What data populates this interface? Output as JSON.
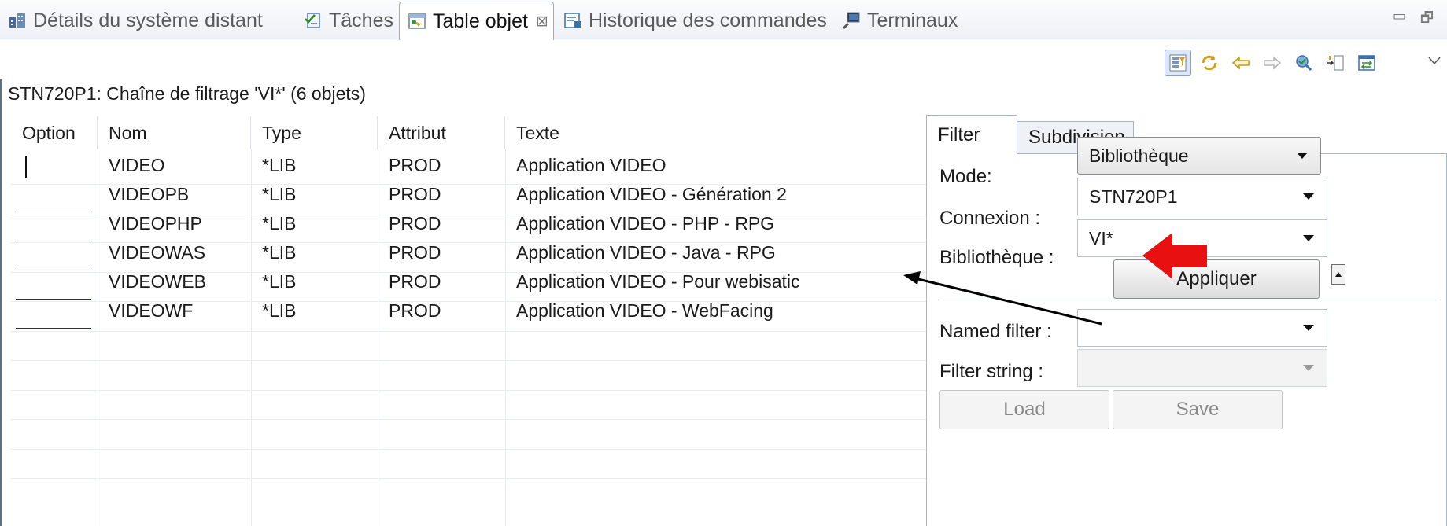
{
  "tabs": [
    {
      "label": "Détails du système distant",
      "icon": "remote-system-details-icon"
    },
    {
      "label": "Tâches",
      "icon": "tasks-icon"
    },
    {
      "label": "Table objet",
      "icon": "object-table-icon",
      "active": true
    },
    {
      "label": "Historique des commandes",
      "icon": "command-history-icon"
    },
    {
      "label": "Terminaux",
      "icon": "terminals-icon"
    }
  ],
  "window_controls": {
    "minimize": "▭",
    "maximize": "🗗"
  },
  "toolbar_icons": [
    "show-filter-panel-icon",
    "refresh-icon",
    "back-icon",
    "forward-icon",
    "remote-search-icon",
    "columns-icon",
    "link-with-editor-icon"
  ],
  "filter_title": "STN720P1: Chaîne de filtrage 'VI*' (6 objets)",
  "table": {
    "columns": [
      "Option",
      "Nom",
      "Type",
      "Attribut",
      "Texte"
    ],
    "rows": [
      {
        "nom": "VIDEO",
        "type": "*LIB",
        "attribut": "PROD",
        "texte": "Application VIDEO"
      },
      {
        "nom": "VIDEOPB",
        "type": "*LIB",
        "attribut": "PROD",
        "texte": "Application VIDEO - Génération 2"
      },
      {
        "nom": "VIDEOPHP",
        "type": "*LIB",
        "attribut": "PROD",
        "texte": "Application VIDEO - PHP - RPG"
      },
      {
        "nom": "VIDEOWAS",
        "type": "*LIB",
        "attribut": "PROD",
        "texte": "Application VIDEO - Java - RPG"
      },
      {
        "nom": "VIDEOWEB",
        "type": "*LIB",
        "attribut": "PROD",
        "texte": "Application VIDEO - Pour webisatic"
      },
      {
        "nom": "VIDEOWF",
        "type": "*LIB",
        "attribut": "PROD",
        "texte": "Application VIDEO - WebFacing"
      }
    ]
  },
  "panel": {
    "tabs": [
      "Filter",
      "Subdivision"
    ],
    "mode_label": "Mode:",
    "mode_value": "Bibliothèque",
    "connexion_label": "Connexion :",
    "connexion_value": "STN720P1",
    "bibliotheque_label": "Bibliothèque :",
    "bibliotheque_value": "VI*",
    "apply_button": "Appliquer",
    "named_filter_label": "Named filter :",
    "named_filter_value": "",
    "filter_string_label": "Filter string :",
    "filter_string_value": "",
    "load_button": "Load",
    "save_button": "Save"
  },
  "colors": {
    "annotation_red": "#e81010",
    "annotation_black": "#000000",
    "tab_border": "#a9b4c4"
  }
}
